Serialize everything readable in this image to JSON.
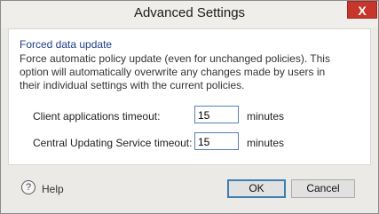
{
  "window": {
    "title": "Advanced Settings",
    "close_glyph": "X"
  },
  "section": {
    "title": "Forced data update",
    "description": "Force automatic policy update (even for unchanged policies). This option will automatically overwrite any changes made by users in their individual settings with the current policies."
  },
  "settings": [
    {
      "label": "Client applications timeout:",
      "value": "15",
      "unit": "minutes"
    },
    {
      "label": "Central Updating Service timeout:",
      "value": "15",
      "unit": "minutes"
    }
  ],
  "footer": {
    "help_icon_glyph": "?",
    "help_label": "Help",
    "ok_label": "OK",
    "cancel_label": "Cancel"
  }
}
